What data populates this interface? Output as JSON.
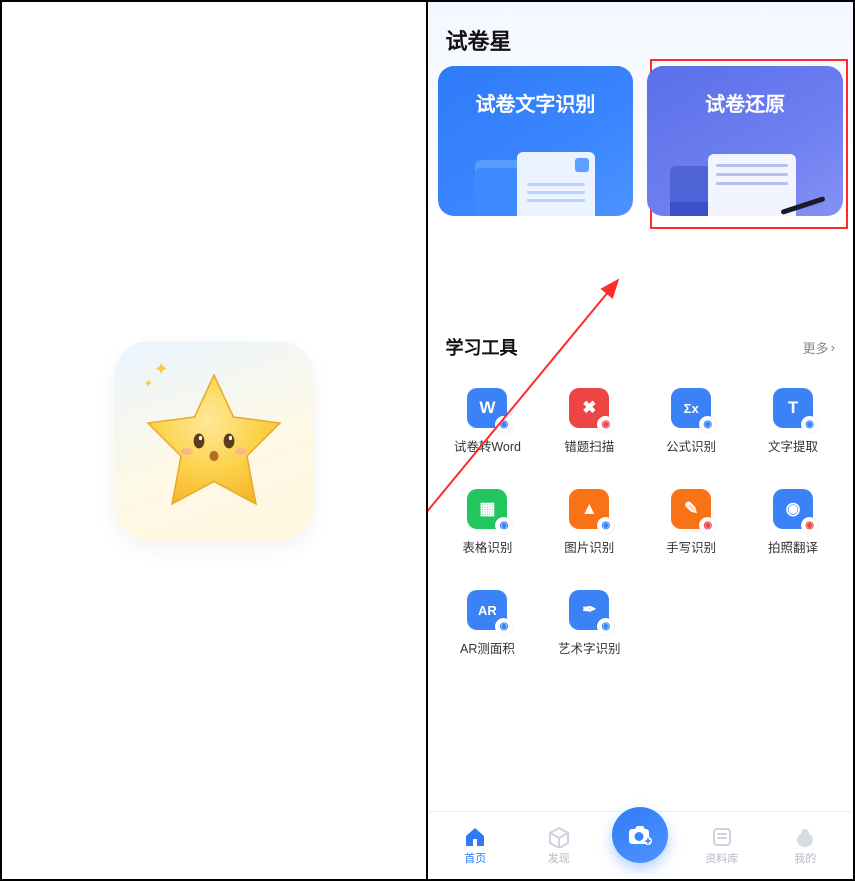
{
  "app_title": "试卷星",
  "feature_cards": {
    "ocr": {
      "title": "试卷文字识别"
    },
    "restore": {
      "title": "试卷还原"
    }
  },
  "tools_section": {
    "title": "学习工具",
    "more_label": "更多"
  },
  "tools": [
    {
      "label": "试卷转Word",
      "color": "blue",
      "glyph": "W",
      "badge": "b-blue"
    },
    {
      "label": "错题扫描",
      "color": "red",
      "glyph": "✖",
      "badge": "b-red"
    },
    {
      "label": "公式识别",
      "color": "blue",
      "glyph": "Σx",
      "badge": "b-blue"
    },
    {
      "label": "文字提取",
      "color": "blue",
      "glyph": "T",
      "badge": "b-blue"
    },
    {
      "label": "表格识别",
      "color": "green",
      "glyph": "▦",
      "badge": "b-blue"
    },
    {
      "label": "图片识别",
      "color": "orange",
      "glyph": "▲",
      "badge": "b-blue"
    },
    {
      "label": "手写识别",
      "color": "orange",
      "glyph": "✎",
      "badge": "b-red"
    },
    {
      "label": "拍照翻译",
      "color": "blue",
      "glyph": "◉",
      "badge": "b-red"
    },
    {
      "label": "AR测面积",
      "color": "blue",
      "glyph": "AR",
      "badge": "b-blue"
    },
    {
      "label": "艺术字识别",
      "color": "blue",
      "glyph": "✒",
      "badge": "b-blue"
    }
  ],
  "tabs": {
    "home": {
      "label": "首页"
    },
    "discover": {
      "label": "发现"
    },
    "library": {
      "label": "资料库"
    },
    "mine": {
      "label": "我的"
    }
  },
  "annotation": {
    "arrow_color": "#ff2a2a",
    "highlight_color": "#ff2a2a"
  }
}
